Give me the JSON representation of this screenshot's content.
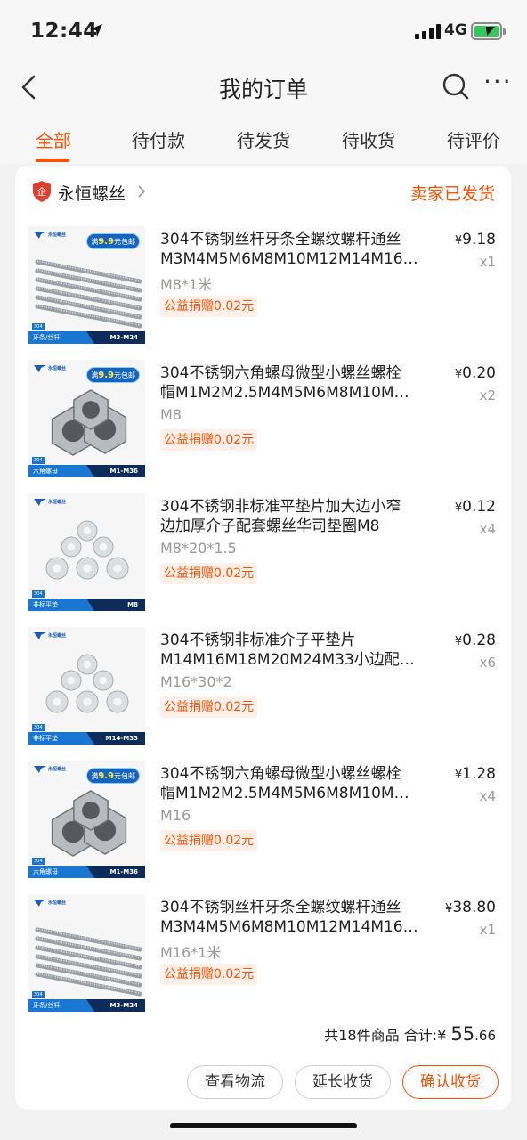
{
  "status_bar": {
    "time": "12:44",
    "network": "4G",
    "battery_charging": true
  },
  "nav": {
    "title": "我的订单",
    "back_icon": "chevron-left-icon",
    "search_icon": "search-icon",
    "more_icon": "ellipsis-icon",
    "more_glyph": "···"
  },
  "tabs": [
    {
      "label": "全部",
      "active": true
    },
    {
      "label": "待付款",
      "active": false
    },
    {
      "label": "待发货",
      "active": false
    },
    {
      "label": "待收货",
      "active": false
    },
    {
      "label": "待评价",
      "active": false
    }
  ],
  "order": {
    "shop_name": "永恒螺丝",
    "shop_icon": "store-shield-icon",
    "status": "卖家已发货",
    "items": [
      {
        "title_line1": "304不锈钢丝杆牙条全螺纹螺杆通丝",
        "title_line2": "M3M4M5M6M8M10M12M14M16…",
        "spec": "M8*1米",
        "donation": "公益捐赠0.02元",
        "price_symbol": "¥",
        "price": "9.18",
        "qty": "x1",
        "thumb": {
          "kind": "rods",
          "brand": "永恒螺丝",
          "promo_prefix": "满",
          "promo_value": "9.9",
          "promo_suffix": "元包邮",
          "grade": "304",
          "category": "牙条/丝杆",
          "range": "M3-M24"
        }
      },
      {
        "title_line1": "304不锈钢六角螺母微型小螺丝螺栓",
        "title_line2": "帽M1M2M2.5M4M5M6M8M10M1…",
        "spec": "M8",
        "donation": "公益捐赠0.02元",
        "price_symbol": "¥",
        "price": "0.20",
        "qty": "x2",
        "thumb": {
          "kind": "nuts",
          "brand": "永恒螺丝",
          "promo_prefix": "满",
          "promo_value": "9.9",
          "promo_suffix": "元包邮",
          "grade": "304",
          "category": "六角螺母",
          "range": "M1-M36"
        }
      },
      {
        "title_line1": "304不锈钢非标准平垫片加大边小窄",
        "title_line2": "边加厚介子配套螺丝华司垫圈M8",
        "spec": "M8*20*1.5",
        "donation": "公益捐赠0.02元",
        "price_symbol": "¥",
        "price": "0.12",
        "qty": "x4",
        "thumb": {
          "kind": "washers",
          "brand": "永恒螺丝",
          "promo_prefix": "",
          "promo_value": "",
          "promo_suffix": "",
          "grade": "304",
          "category": "非标平垫",
          "range": "M8"
        }
      },
      {
        "title_line1": "304不锈钢非标准介子平垫片",
        "title_line2": "M14M16M18M20M24M33小边配…",
        "spec": "M16*30*2",
        "donation": "公益捐赠0.02元",
        "price_symbol": "¥",
        "price": "0.28",
        "qty": "x6",
        "thumb": {
          "kind": "washers",
          "brand": "永恒螺丝",
          "promo_prefix": "",
          "promo_value": "",
          "promo_suffix": "",
          "grade": "304",
          "category": "非标平垫",
          "range": "M14-M33"
        }
      },
      {
        "title_line1": "304不锈钢六角螺母微型小螺丝螺栓",
        "title_line2": "帽M1M2M2.5M4M5M6M8M10M1…",
        "spec": "M16",
        "donation": "公益捐赠0.02元",
        "price_symbol": "¥",
        "price": "1.28",
        "qty": "x4",
        "thumb": {
          "kind": "nuts",
          "brand": "永恒螺丝",
          "promo_prefix": "满",
          "promo_value": "9.9",
          "promo_suffix": "元包邮",
          "grade": "304",
          "category": "六角螺母",
          "range": "M1-M36"
        }
      },
      {
        "title_line1": "304不锈钢丝杆牙条全螺纹螺杆通丝",
        "title_line2": "M3M4M5M6M8M10M12M14M16…",
        "spec": "M16*1米",
        "donation": "公益捐赠0.02元",
        "price_symbol": "¥",
        "price": "38.80",
        "qty": "x1",
        "thumb": {
          "kind": "rods",
          "brand": "永恒螺丝",
          "promo_prefix": "",
          "promo_value": "",
          "promo_suffix": "",
          "grade": "304",
          "category": "牙条/丝杆",
          "range": "M3-M24"
        }
      }
    ],
    "summary": {
      "count_text": "共18件商品",
      "total_label": "合计:",
      "currency": "¥",
      "total_int": "55",
      "total_dec": ".66"
    },
    "actions": {
      "logistics": "查看物流",
      "extend": "延长收货",
      "confirm": "确认收货"
    }
  },
  "colors": {
    "accent": "#ff5000",
    "donation_bg": "#fff1ea",
    "text_muted": "#999999"
  }
}
